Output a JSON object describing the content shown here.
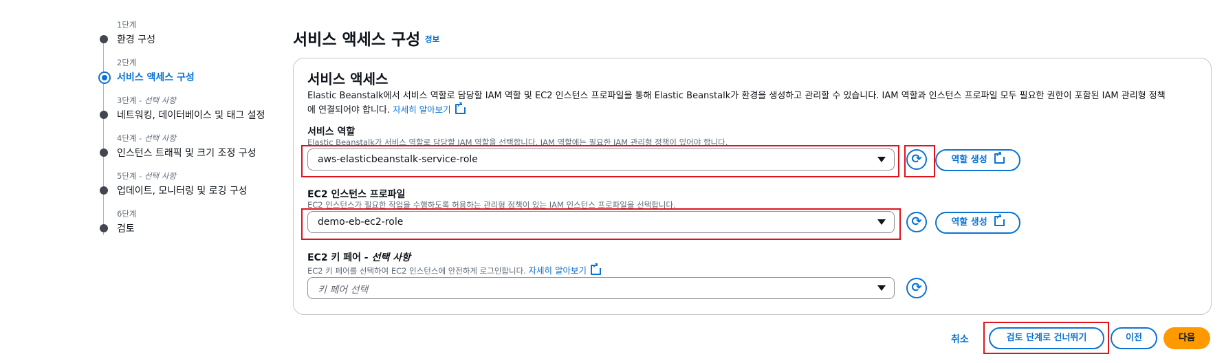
{
  "stepper": {
    "steps": [
      {
        "label": "1단계",
        "optional": "",
        "title": "환경 구성",
        "active": false
      },
      {
        "label": "2단계",
        "optional": "",
        "title": "서비스 액세스 구성",
        "active": true
      },
      {
        "label": "3단계",
        "optional": " - 선택 사항",
        "title": "네트워킹, 데이터베이스 및 태그 설정",
        "active": false
      },
      {
        "label": "4단계",
        "optional": " - 선택 사항",
        "title": "인스턴스 트래픽 및 크기 조정 구성",
        "active": false
      },
      {
        "label": "5단계",
        "optional": " - 선택 사항",
        "title": "업데이트, 모니터링 및 로깅 구성",
        "active": false
      },
      {
        "label": "6단계",
        "optional": "",
        "title": "검토",
        "active": false
      }
    ]
  },
  "page": {
    "title": "서비스 액세스 구성",
    "info_link": "정보"
  },
  "service_access": {
    "title": "서비스 액세스",
    "description_line1": "Elastic Beanstalk에서 서비스 역할로 담당할 IAM 역할 및 EC2 인스턴스 프로파일을 통해 Elastic Beanstalk가 환경을 생성하고 관리할 수 있습니다. IAM 역할과 인스턴스 프로파일 모두 필요한 권한이 포함된 IAM 관리형 정책",
    "description_line2": "에 연결되어야 합니다.",
    "learn_more": "자세히 알아보기",
    "service_role": {
      "label": "서비스 역할",
      "hint": "Elastic Beanstalk가 서비스 역할로 담당할 IAM 역할을 선택합니다. IAM 역할에는 필요한 IAM 관리형 정책이 있어야 합니다.",
      "value": "aws-elasticbeanstalk-service-role",
      "create_button": "역할 생성"
    },
    "instance_profile": {
      "label": "EC2 인스턴스 프로파일",
      "hint": "EC2 인스턴스가 필요한 작업을 수행하도록 허용하는 관리형 정책이 있는 IAM 인스턴스 프로파일을 선택합니다.",
      "value": "demo-eb-ec2-role",
      "create_button": "역할 생성"
    },
    "key_pair": {
      "label": "EC2 키 페어",
      "label_optional": " - 선택 사항",
      "hint": "EC2 키 페어를 선택하여 EC2 인스턴스에 안전하게 로그인합니다.",
      "learn_more": "자세히 알아보기",
      "placeholder": "키 페어 선택"
    }
  },
  "icons": {
    "refresh": "refresh-icon",
    "external": "external-link-icon",
    "caret": "caret-down-icon"
  },
  "footer": {
    "cancel": "취소",
    "skip_to_review": "검토 단계로 건너뛰기",
    "previous": "이전",
    "next": "다음"
  },
  "colors": {
    "accent": "#0972d3",
    "primary_button": "#ff9900",
    "highlight": "#e0121c"
  }
}
